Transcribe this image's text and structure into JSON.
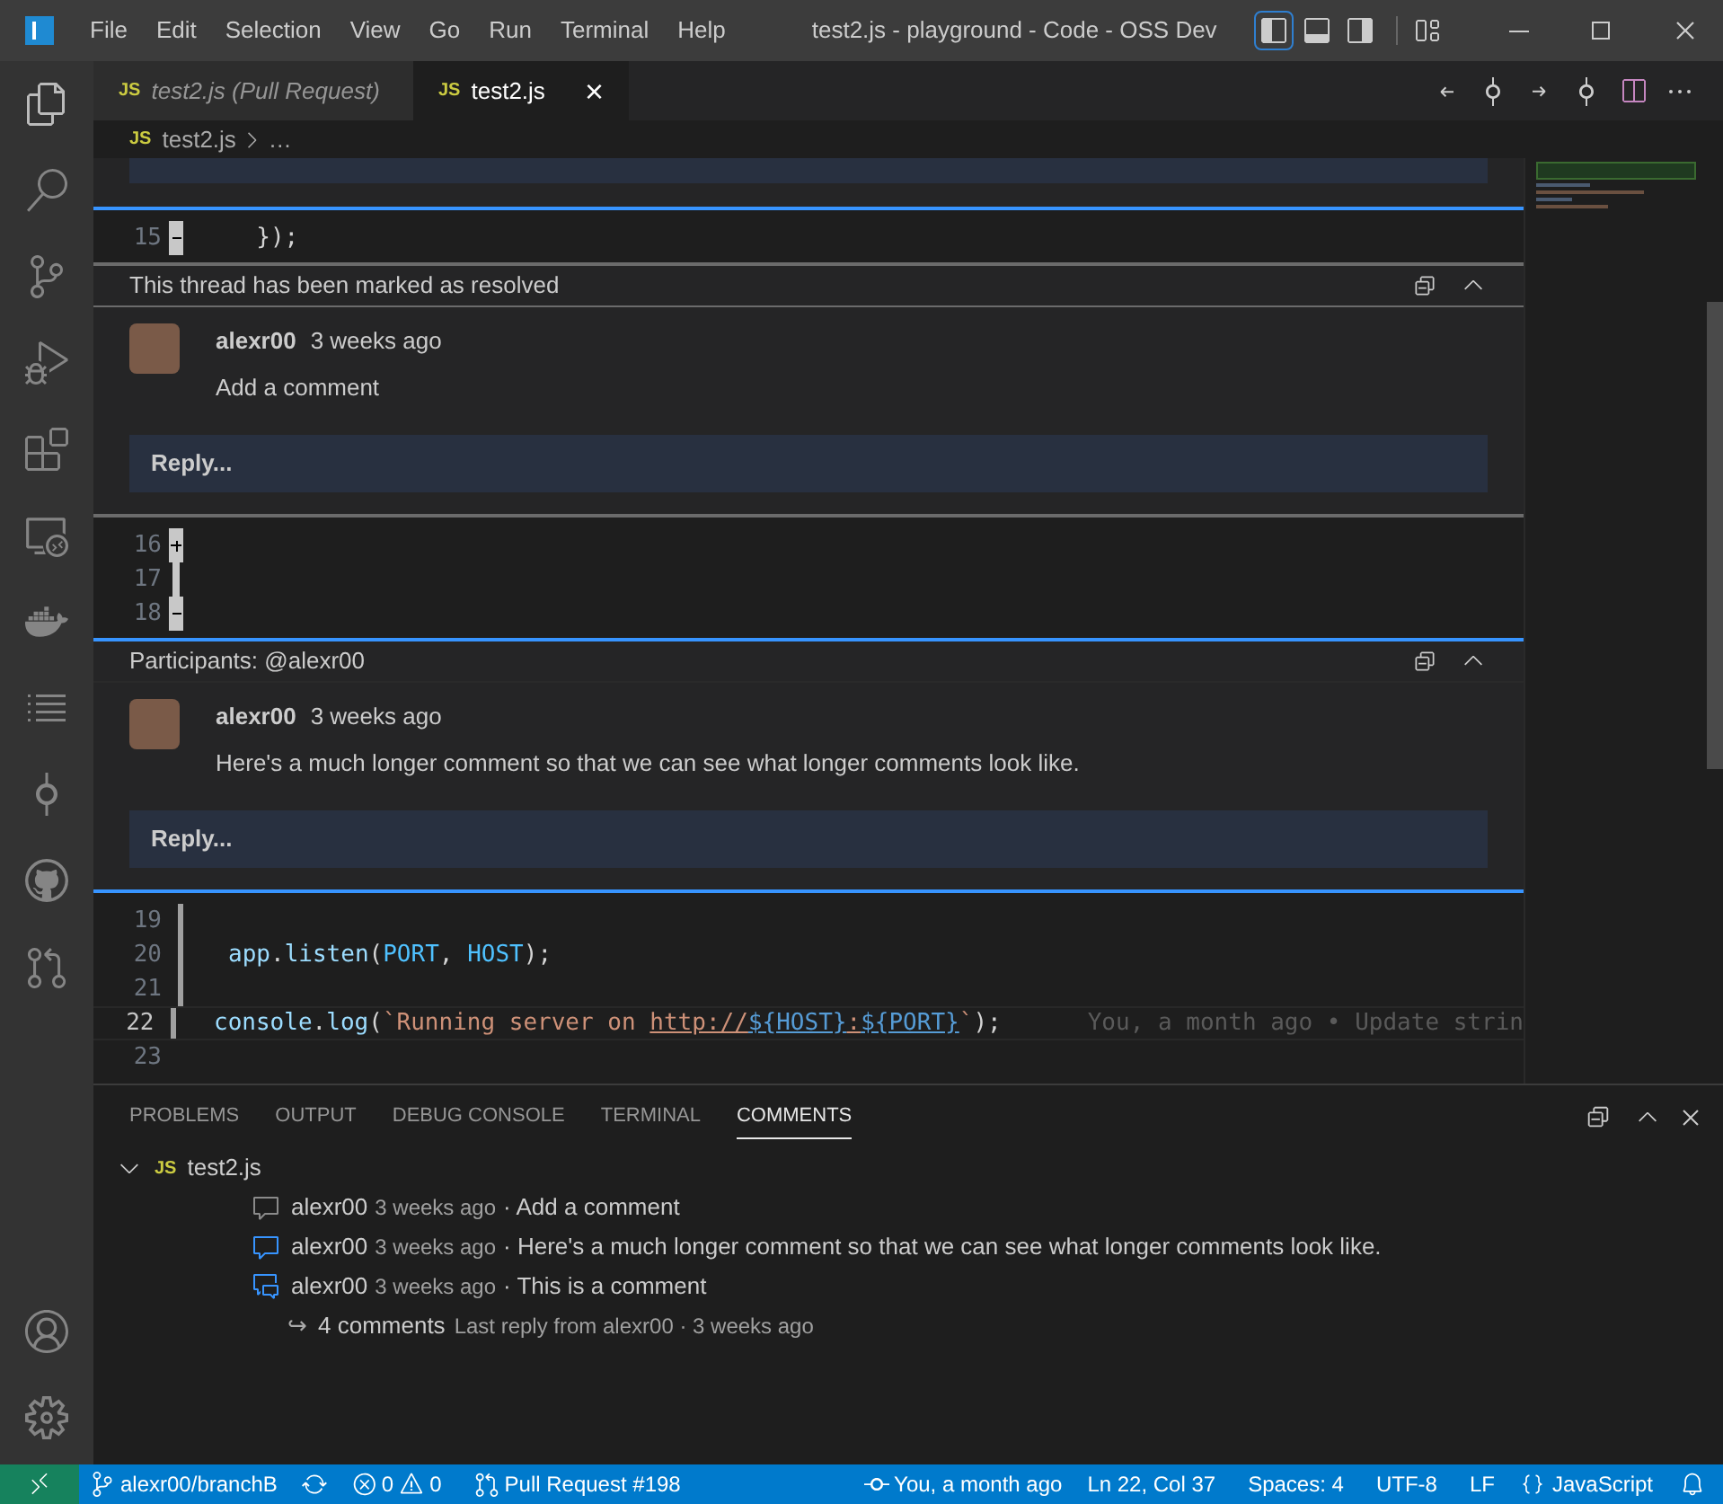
{
  "menu": [
    "File",
    "Edit",
    "Selection",
    "View",
    "Go",
    "Run",
    "Terminal",
    "Help"
  ],
  "window": {
    "title": "test2.js - playground - Code - OSS Dev"
  },
  "layout_toggles": [
    {
      "kind": "sidebar",
      "selected": true
    },
    {
      "kind": "panel",
      "selected": false
    },
    {
      "kind": "secondary",
      "selected": false
    }
  ],
  "activity_bar": [
    {
      "kind": "explorer",
      "selected": true
    },
    {
      "kind": "search",
      "selected": false
    },
    {
      "kind": "scm",
      "selected": false
    },
    {
      "kind": "debug",
      "selected": false
    },
    {
      "kind": "extensions",
      "selected": false
    },
    {
      "kind": "remote",
      "selected": false
    },
    {
      "kind": "docker",
      "selected": false
    },
    {
      "kind": "list",
      "selected": false
    },
    {
      "kind": "gitlens",
      "selected": false
    },
    {
      "kind": "github",
      "selected": false
    },
    {
      "kind": "pr",
      "selected": false
    }
  ],
  "tabs": [
    {
      "icon": "JS",
      "label": "test2.js (Pull Request)",
      "italic": true,
      "selected": false
    },
    {
      "icon": "JS",
      "label": "test2.js",
      "italic": false,
      "selected": true,
      "close": "×"
    }
  ],
  "breadcrumb": {
    "icon": "JS",
    "file": "test2.js",
    "rest": "…"
  },
  "editor": [
    {
      "kind": "reply_stub"
    },
    {
      "kind": "code",
      "number": "15",
      "removed": true,
      "added": false,
      "in_range": false,
      "modified": false,
      "current": false,
      "tokens": [
        {
          "text": "  });",
          "color": "#d4d4d4"
        }
      ]
    },
    {
      "kind": "thread",
      "resolved": true,
      "header": "This thread has been marked as resolved",
      "author": "alexr00",
      "time": "3 weeks ago",
      "body": "Add a comment",
      "reply": "Reply..."
    },
    {
      "kind": "code",
      "number": "16",
      "removed": false,
      "added": true,
      "in_range": false,
      "modified": false,
      "current": false
    },
    {
      "kind": "code",
      "number": "17",
      "removed": false,
      "added": false,
      "in_range": true,
      "modified": false,
      "current": false
    },
    {
      "kind": "code",
      "number": "18",
      "removed": true,
      "added": false,
      "in_range": false,
      "modified": false,
      "current": false
    },
    {
      "kind": "thread",
      "resolved": false,
      "header": "Participants: @alexr00",
      "author": "alexr00",
      "time": "3 weeks ago",
      "body": "Here's a much longer comment so that we can see what longer comments look like.",
      "reply": "Reply..."
    },
    {
      "kind": "code",
      "number": "19",
      "removed": false,
      "added": false,
      "in_range": false,
      "modified": true,
      "current": false
    },
    {
      "kind": "code",
      "number": "20",
      "removed": false,
      "added": false,
      "in_range": false,
      "modified": true,
      "current": false,
      "tokens": [
        {
          "text": "app",
          "color": "#9cdcfe"
        },
        {
          "text": ".",
          "color": "#d4d4d4"
        },
        {
          "text": "listen",
          "color": "#9cdcfe"
        },
        {
          "text": "(",
          "color": "#d4d4d4"
        },
        {
          "text": "PORT",
          "color": "#4fc1ff"
        },
        {
          "text": ", ",
          "color": "#d4d4d4"
        },
        {
          "text": "HOST",
          "color": "#4fc1ff"
        },
        {
          "text": ");",
          "color": "#d4d4d4"
        }
      ]
    },
    {
      "kind": "code",
      "number": "21",
      "removed": false,
      "added": false,
      "in_range": false,
      "modified": true,
      "current": false
    },
    {
      "kind": "code",
      "number": "22",
      "removed": false,
      "added": false,
      "in_range": false,
      "modified": true,
      "current": true,
      "blame": "You, a month ago • Update strin",
      "tokens": [
        {
          "text": "console",
          "color": "#9cdcfe"
        },
        {
          "text": ".",
          "color": "#d4d4d4"
        },
        {
          "text": "log",
          "color": "#9cdcfe"
        },
        {
          "text": "(",
          "color": "#d4d4d4"
        },
        {
          "text": "`Running server on ",
          "color": "#ce9178"
        },
        {
          "text": "http://",
          "color": "#ce9178",
          "underline": true
        },
        {
          "text": "${HOST}",
          "color": "#569cd6",
          "underline": true
        },
        {
          "text": ":",
          "color": "#ce9178",
          "underline": true
        },
        {
          "text": "${PORT}",
          "color": "#569cd6",
          "underline": true
        },
        {
          "text": "`",
          "color": "#ce9178"
        },
        {
          "text": ");",
          "color": "#d4d4d4"
        }
      ]
    },
    {
      "kind": "code",
      "number": "23",
      "removed": false,
      "added": false,
      "in_range": false,
      "modified": false,
      "current": false
    }
  ],
  "panel": {
    "tabs": [
      {
        "label": "PROBLEMS",
        "selected": false
      },
      {
        "label": "OUTPUT",
        "selected": false
      },
      {
        "label": "DEBUG CONSOLE",
        "selected": false
      },
      {
        "label": "TERMINAL",
        "selected": false
      },
      {
        "label": "COMMENTS",
        "selected": true
      }
    ],
    "tree": {
      "icon": "JS",
      "file": "test2.js",
      "expanded": true,
      "children": [
        {
          "kind": "resolved",
          "author": "alexr00",
          "time": "3 weeks ago",
          "text": "· Add a comment"
        },
        {
          "kind": "unresolved",
          "author": "alexr00",
          "time": "3 weeks ago",
          "text": "· Here's a much longer comment so that we can see what longer comments look like."
        },
        {
          "kind": "replies",
          "author": "alexr00",
          "time": "3 weeks ago",
          "text": "· This is a comment",
          "expanded": true,
          "children": [
            {
              "arrow": "↪",
              "count": "4 comments",
              "detail": "Last reply from alexr00 · 3 weeks ago"
            }
          ]
        }
      ]
    }
  },
  "status_bar": {
    "left": [
      {
        "kind": "branch",
        "text": "alexr00/branchB"
      },
      {
        "kind": "sync"
      },
      {
        "kind": "problems",
        "errors": "0",
        "warnings": "0"
      },
      {
        "kind": "pr",
        "text": "Pull Request #198"
      }
    ],
    "right": [
      {
        "kind": "blame",
        "text": "You, a month ago"
      },
      {
        "kind": "text",
        "text": "Ln 22, Col 37"
      },
      {
        "kind": "text",
        "text": "Spaces: 4"
      },
      {
        "kind": "text",
        "text": "UTF-8"
      },
      {
        "kind": "text",
        "text": "LF"
      },
      {
        "kind": "lang",
        "text": "JavaScript"
      },
      {
        "kind": "bell"
      }
    ]
  }
}
